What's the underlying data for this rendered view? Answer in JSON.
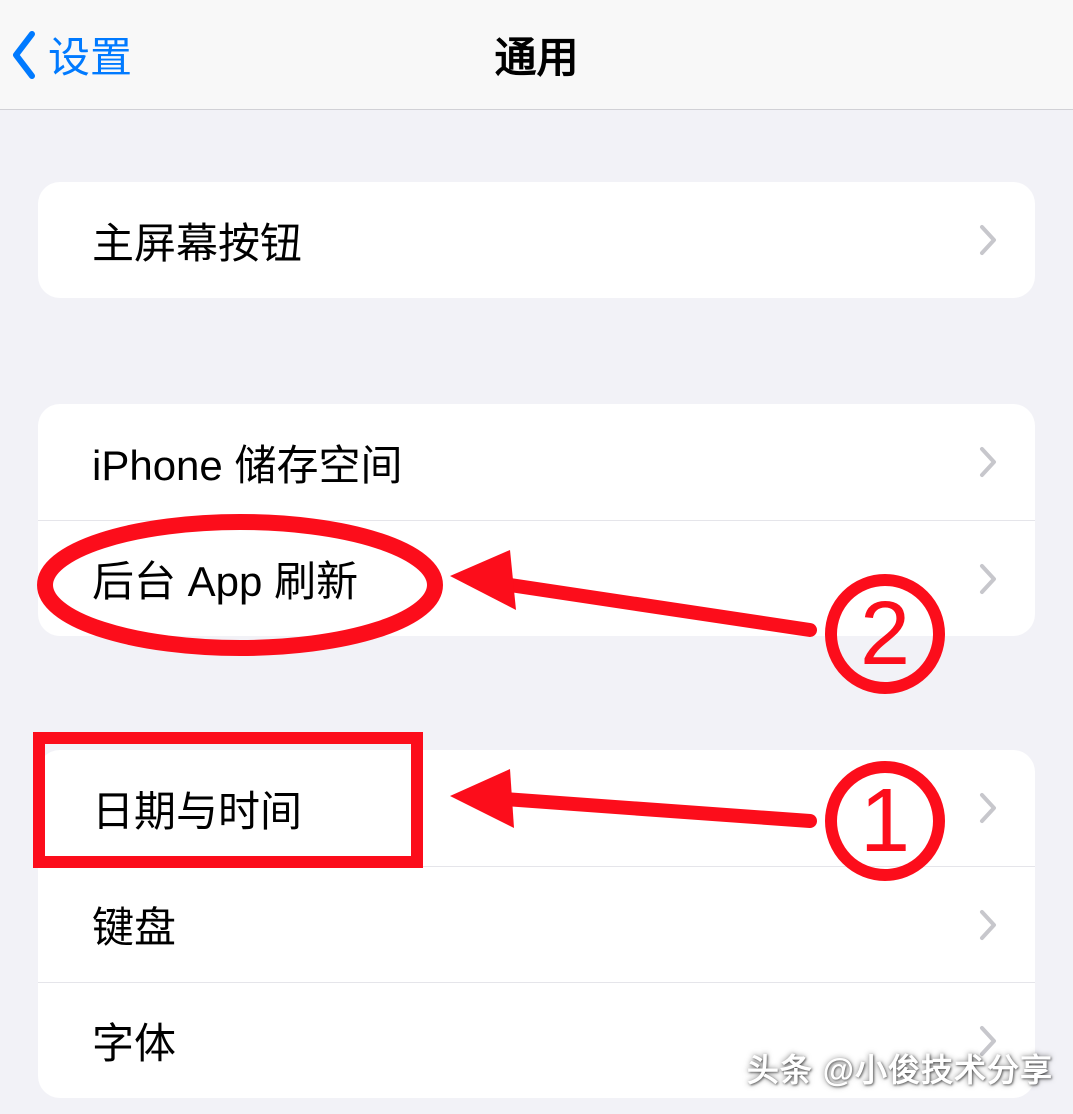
{
  "navbar": {
    "back_label": "设置",
    "title": "通用"
  },
  "groups": [
    {
      "rows": [
        {
          "label": "主屏幕按钮"
        }
      ]
    },
    {
      "rows": [
        {
          "label": "iPhone 储存空间"
        },
        {
          "label": "后台 App 刷新"
        }
      ]
    },
    {
      "rows": [
        {
          "label": "日期与时间"
        },
        {
          "label": "键盘"
        },
        {
          "label": "字体"
        }
      ]
    }
  ],
  "annotations": {
    "marker_1": "1",
    "marker_2": "2"
  },
  "watermark": "头条 @小俊技术分享"
}
